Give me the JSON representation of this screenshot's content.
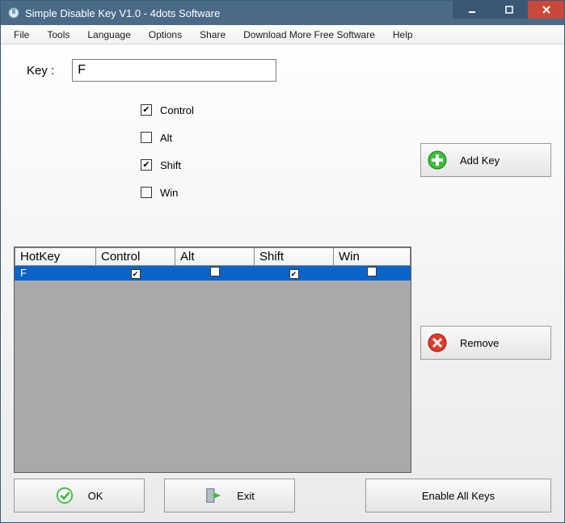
{
  "titlebar": {
    "title": "Simple Disable Key V1.0 - 4dots Software"
  },
  "menu": {
    "file": "File",
    "tools": "Tools",
    "language": "Language",
    "options": "Options",
    "share": "Share",
    "download": "Download More Free Software",
    "help": "Help"
  },
  "form": {
    "key_label": "Key :",
    "key_value": "F",
    "mods": {
      "control_label": "Control",
      "control_checked": true,
      "alt_label": "Alt",
      "alt_checked": false,
      "shift_label": "Shift",
      "shift_checked": true,
      "win_label": "Win",
      "win_checked": false
    }
  },
  "buttons": {
    "add_key": "Add Key",
    "remove": "Remove",
    "ok": "OK",
    "exit": "Exit",
    "enable_all": "Enable All Keys"
  },
  "grid": {
    "columns": {
      "hotkey": "HotKey",
      "control": "Control",
      "alt": "Alt",
      "shift": "Shift",
      "win": "Win"
    },
    "rows": [
      {
        "hotkey": "F",
        "control": true,
        "alt": false,
        "shift": true,
        "win": false
      }
    ]
  }
}
